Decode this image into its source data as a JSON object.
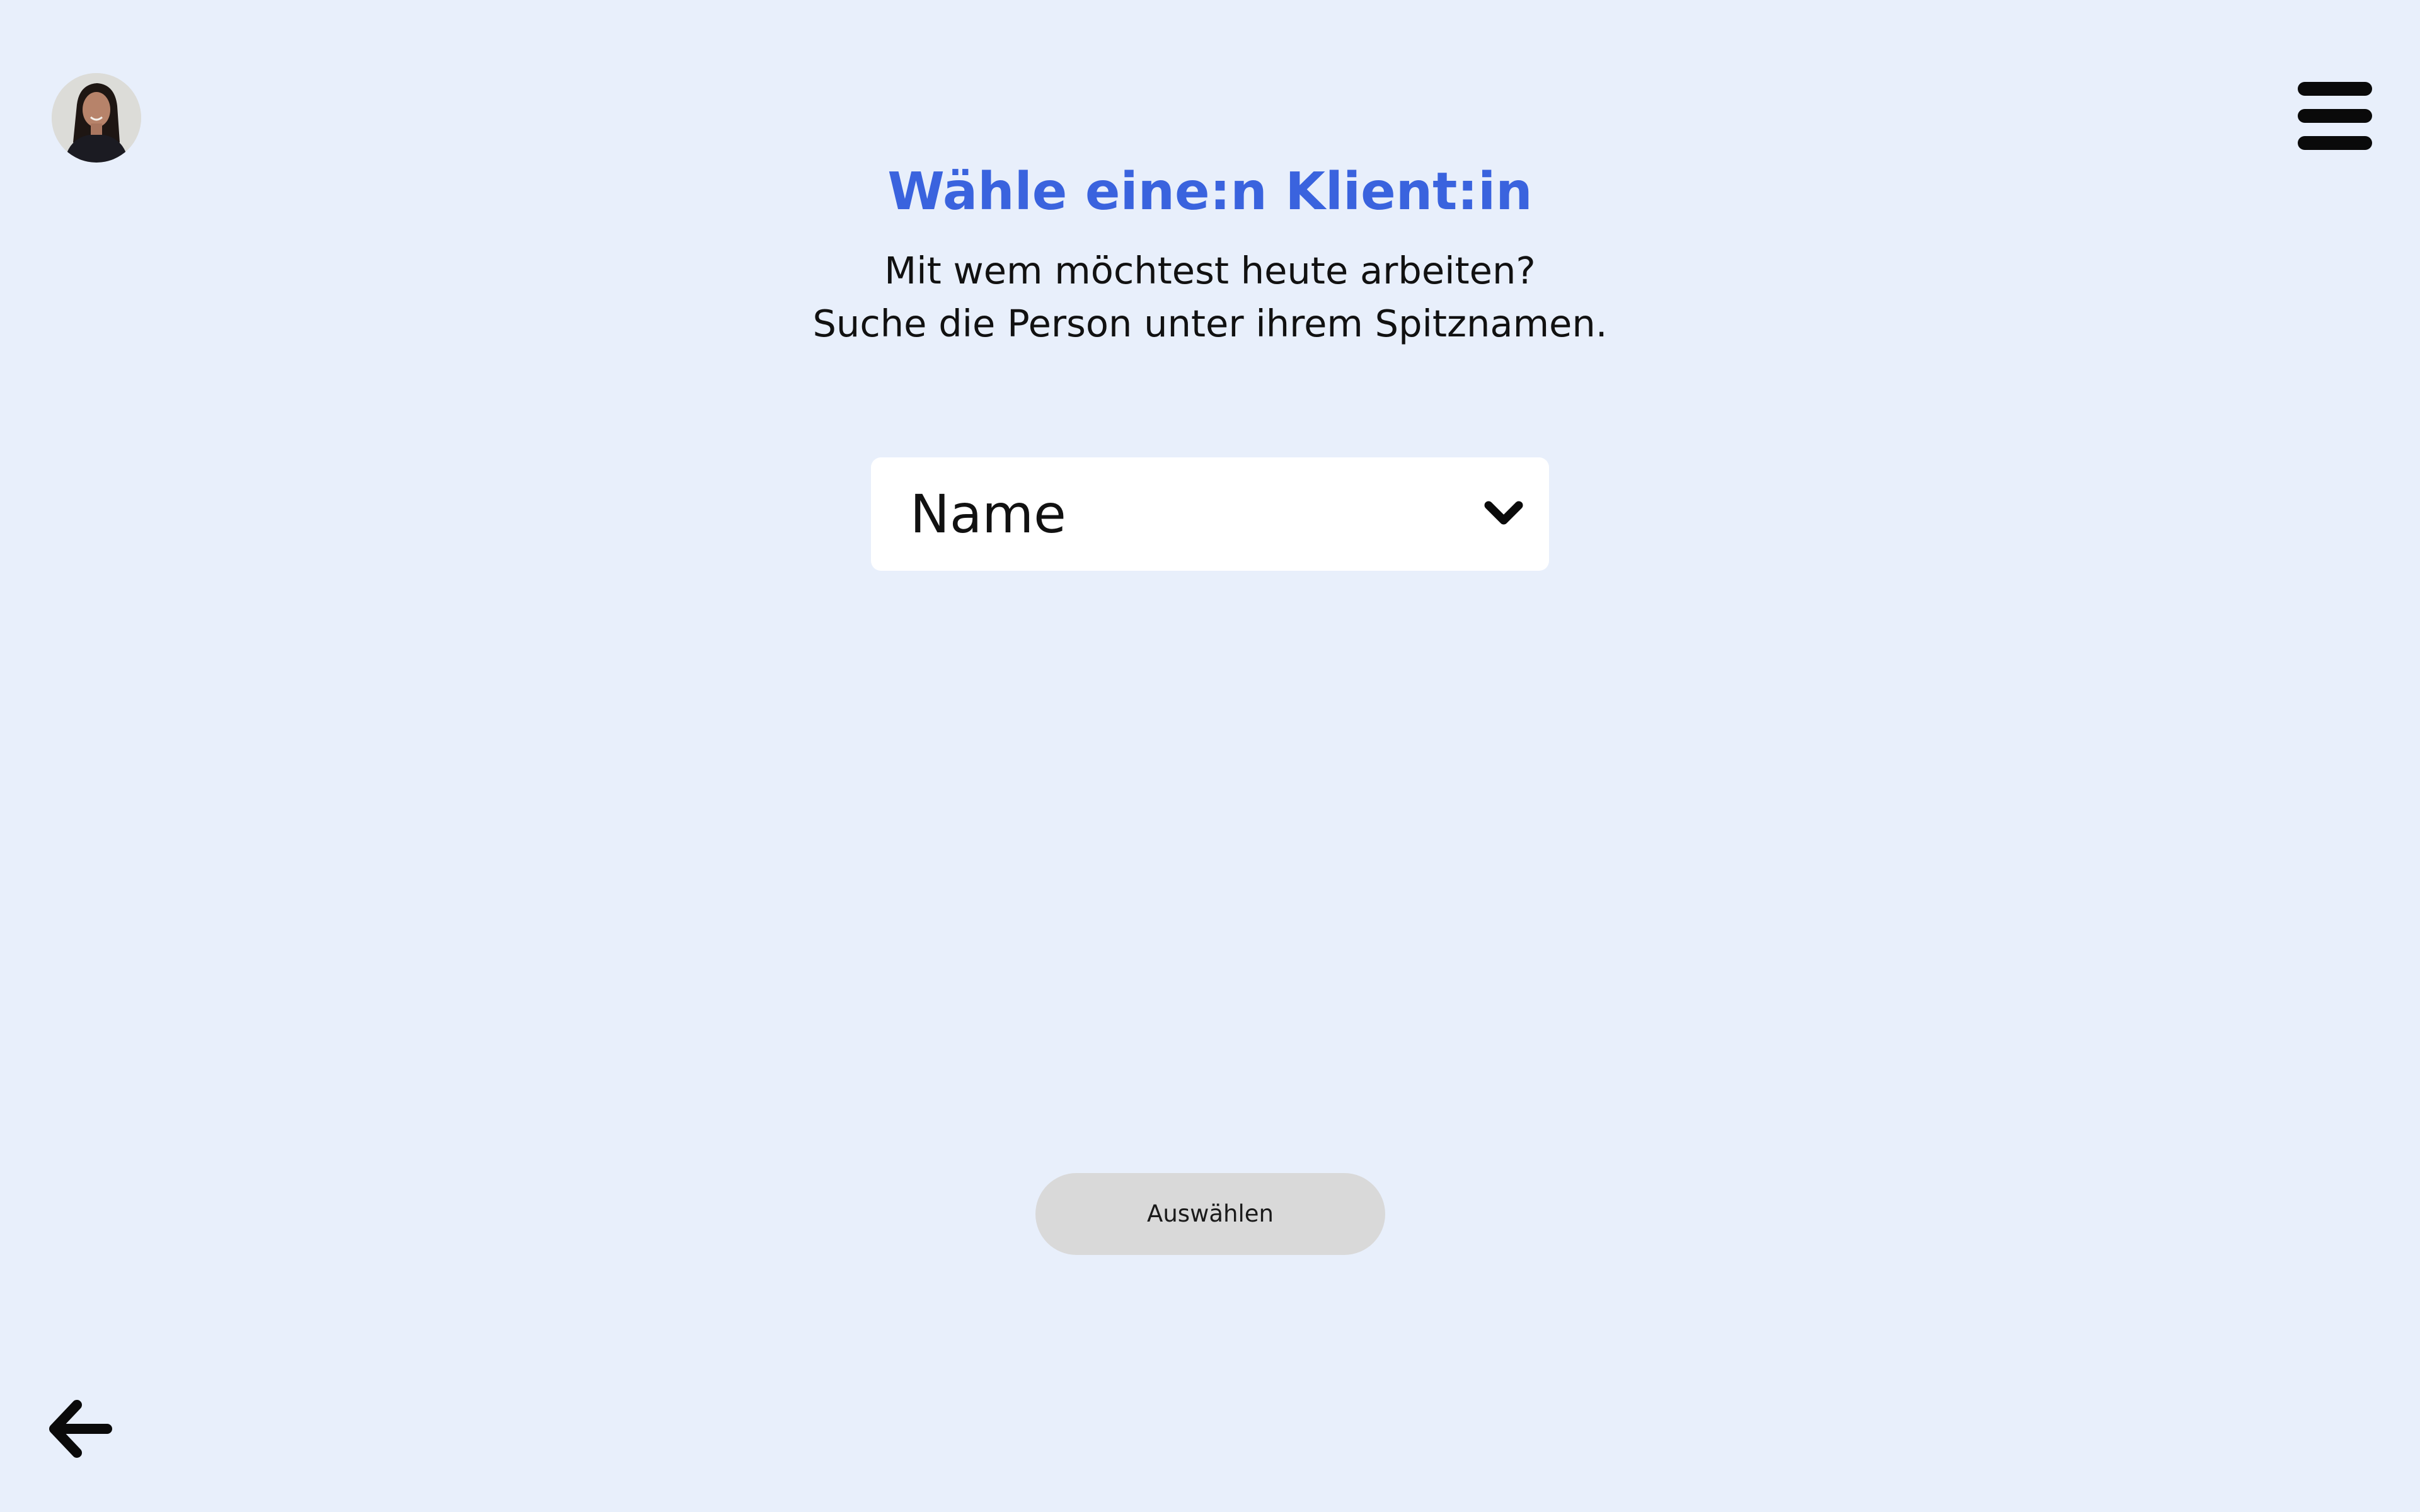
{
  "header": {
    "avatar_icon": "user-avatar-photo",
    "menu_icon": "hamburger-menu-icon"
  },
  "main": {
    "title": "Wähle eine:n Klient:in",
    "subtitle_line1": "Mit wem möchtest heute arbeiten?",
    "subtitle_line2": "Suche die Person unter ihrem Spitznamen.",
    "select": {
      "value": "Name",
      "icon": "chevron-down-icon"
    },
    "submit_label": "Auswählen"
  },
  "footer": {
    "back_icon": "arrow-left-icon"
  },
  "colors": {
    "background": "#e8effb",
    "accent": "#3a63de",
    "button_disabled": "#d9d9d9"
  }
}
